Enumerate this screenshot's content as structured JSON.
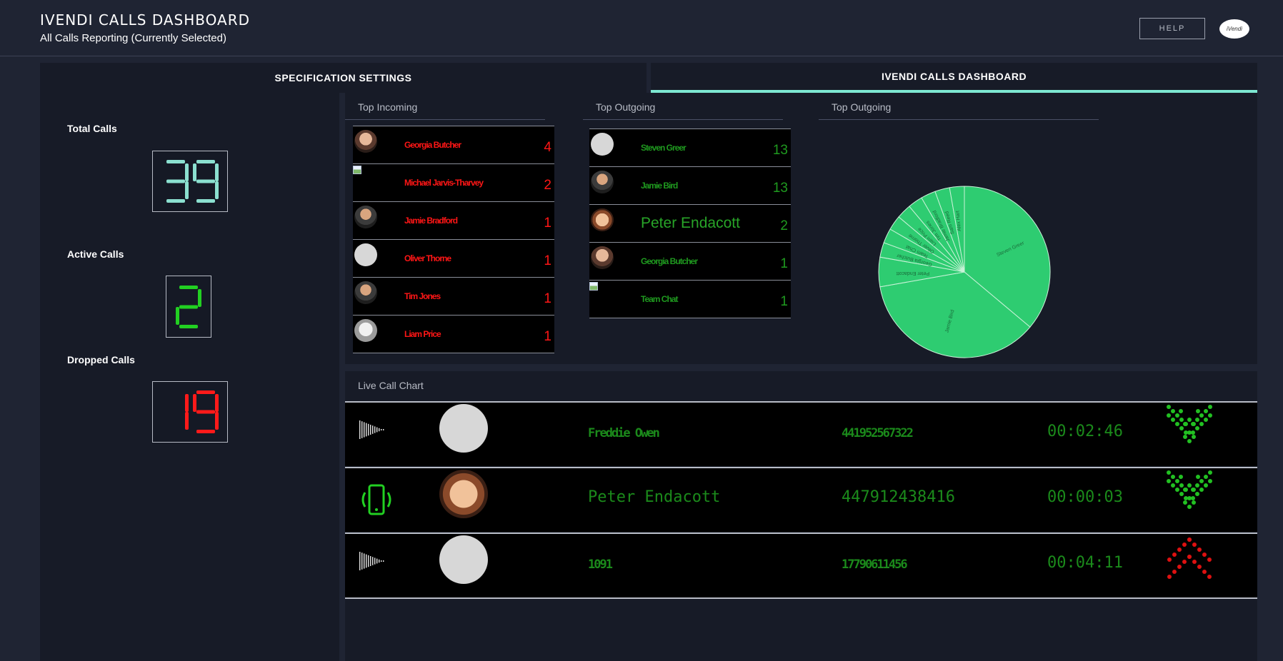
{
  "header": {
    "title": "IVENDI CALLS DASHBOARD",
    "subtitle": "All Calls Reporting (Currently Selected)",
    "help_label": "HELP",
    "logo_text": "iVendi"
  },
  "tabs": [
    {
      "label": "SPECIFICATION SETTINGS",
      "active": false
    },
    {
      "label": "IVENDI CALLS DASHBOARD",
      "active": true
    }
  ],
  "stats": {
    "total": {
      "label": "Total Calls",
      "value": "39",
      "color": "#8be0d0"
    },
    "active": {
      "label": "Active Calls",
      "value": "2",
      "color": "#22d022"
    },
    "dropped": {
      "label": "Dropped Calls",
      "value": "19",
      "color": "#ff1a1a"
    }
  },
  "top_incoming": {
    "title": "Top Incoming",
    "rows": [
      {
        "name": "Georgia Butcher",
        "count": "4",
        "avatar": "photo"
      },
      {
        "name": "Michael Jarvis-Tharvey",
        "count": "2",
        "avatar": "broken"
      },
      {
        "name": "Jamie Bradford",
        "count": "1",
        "avatar": "photo2"
      },
      {
        "name": "Oliver Thorne",
        "count": "1",
        "avatar": "generic"
      },
      {
        "name": "Tim Jones",
        "count": "1",
        "avatar": "photo2"
      },
      {
        "name": "Liam Price",
        "count": "1",
        "avatar": "light"
      }
    ]
  },
  "top_outgoing": {
    "title": "Top Outgoing",
    "rows": [
      {
        "name": "Steven Greer",
        "count": "13",
        "avatar": "generic",
        "clear": false
      },
      {
        "name": "Jamie Bird",
        "count": "13",
        "avatar": "photo2",
        "clear": false
      },
      {
        "name": "Peter Endacott",
        "count": "2",
        "avatar": "face",
        "clear": true
      },
      {
        "name": "Georgia Butcher",
        "count": "1",
        "avatar": "photo",
        "clear": false
      },
      {
        "name": "Team Chat",
        "count": "1",
        "avatar": "broken",
        "clear": false
      }
    ]
  },
  "pie_section": {
    "title": "Top Outgoing"
  },
  "chart_data": {
    "type": "pie",
    "title": "Top Outgoing",
    "slice_color": "#2ecc71",
    "values": [
      13,
      13,
      2,
      1,
      1,
      1,
      1,
      1,
      1,
      1,
      1
    ],
    "labels": [
      "Steven Greer",
      "Jamie Bird",
      "Peter Endacott",
      "Georgia Butcher",
      "Team Chat",
      "Oliver Thorne",
      "Liam Price",
      "Tim Jones",
      "Jamie Bradford",
      "Sam Reed",
      "Alex Hart"
    ]
  },
  "live": {
    "title": "Live Call Chart",
    "calls": [
      {
        "icon": "wave",
        "avatar": "generic",
        "name": "Freddie Owen",
        "number": "441952567322",
        "duration": "00:02:46",
        "direction": "incoming",
        "clear": false
      },
      {
        "icon": "phone",
        "avatar": "face",
        "name": "Peter Endacott",
        "number": "447912438416",
        "duration": "00:00:03",
        "direction": "incoming",
        "clear": true
      },
      {
        "icon": "wave",
        "avatar": "generic",
        "name": "1091",
        "number": "17790611456",
        "duration": "00:04:11",
        "direction": "outgoing",
        "clear": false
      }
    ]
  }
}
